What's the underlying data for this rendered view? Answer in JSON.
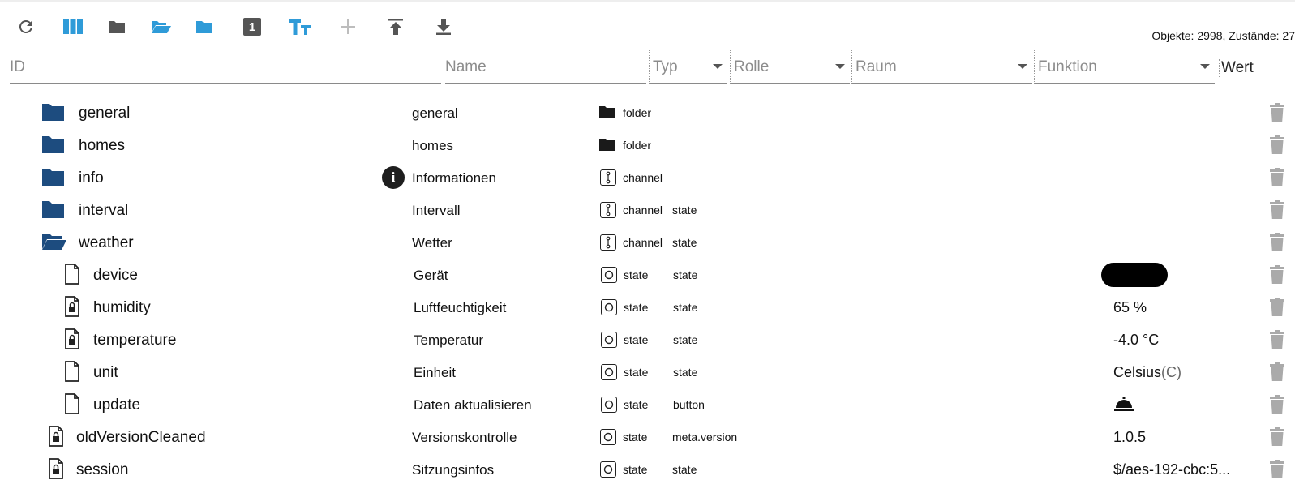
{
  "toolbar": {
    "buttons": [
      {
        "name": "refresh-button",
        "icon": "refresh-icon"
      },
      {
        "name": "columns-button",
        "icon": "columns-icon"
      },
      {
        "name": "folder-button",
        "icon": "folder-icon"
      },
      {
        "name": "open-folder-button",
        "icon": "folder-open-icon"
      },
      {
        "name": "close-folder-button",
        "icon": "folder-icon"
      },
      {
        "name": "expert-mode-button",
        "label": "1"
      },
      {
        "name": "text-size-button",
        "icon": "text-size-icon"
      },
      {
        "name": "add-button",
        "icon": "plus-icon"
      },
      {
        "name": "upload-button",
        "icon": "upload-icon"
      },
      {
        "name": "download-button",
        "icon": "download-icon"
      }
    ],
    "counts": "Objekte: 2998, Zustände: 27"
  },
  "filters": {
    "id_placeholder": "ID",
    "name_placeholder": "Name",
    "typ_label": "Typ",
    "rolle_label": "Rolle",
    "raum_label": "Raum",
    "funktion_label": "Funktion",
    "wert_label": "Wert"
  },
  "rows": [
    {
      "id": "general",
      "name": "general",
      "type": "folder",
      "role": "",
      "value": "",
      "icon": "folder-icon"
    },
    {
      "id": "homes",
      "name": "homes",
      "type": "folder",
      "role": "",
      "value": "",
      "icon": "folder-icon"
    },
    {
      "id": "info",
      "name": "Informationen",
      "type": "channel",
      "role": "",
      "value": "",
      "icon": "folder-icon"
    },
    {
      "id": "interval",
      "name": "Intervall",
      "type": "channel",
      "role": "state",
      "value": "",
      "icon": "folder-icon"
    },
    {
      "id": "weather",
      "name": "Wetter",
      "type": "channel",
      "role": "state",
      "value": "",
      "icon": "folder-open-icon"
    },
    {
      "id": "device",
      "name": "Gerät",
      "type": "state",
      "role": "state",
      "value": "",
      "icon": "file-icon"
    },
    {
      "id": "humidity",
      "name": "Luftfeuchtigkeit",
      "type": "state",
      "role": "state",
      "value": "65",
      "unit": "%",
      "icon": "file-lock-icon"
    },
    {
      "id": "temperature",
      "name": "Temperatur",
      "type": "state",
      "role": "state",
      "value": "-4.0",
      "unit": "°C",
      "icon": "file-lock-icon"
    },
    {
      "id": "unit",
      "name": "Einheit",
      "type": "state",
      "role": "state",
      "value": "Celsius",
      "unit": "(C)",
      "icon": "file-icon"
    },
    {
      "id": "update",
      "name": "Daten aktualisieren",
      "type": "state",
      "role": "button",
      "value": "",
      "icon": "file-icon"
    },
    {
      "id": "oldVersionCleaned",
      "name": "Versionskontrolle",
      "type": "state",
      "role": "meta.version",
      "value": "1.0.5",
      "icon": "file-lock-icon"
    },
    {
      "id": "session",
      "name": "Sitzungsinfos",
      "type": "state",
      "role": "state",
      "value": "$/aes-192-cbc:5...",
      "icon": "file-lock-icon"
    }
  ],
  "colors": {
    "accent": "#2f9bd8",
    "folder_dark": "#1d4c7f",
    "icon_gray": "#555555",
    "trash_gray": "#aaaaaa"
  }
}
